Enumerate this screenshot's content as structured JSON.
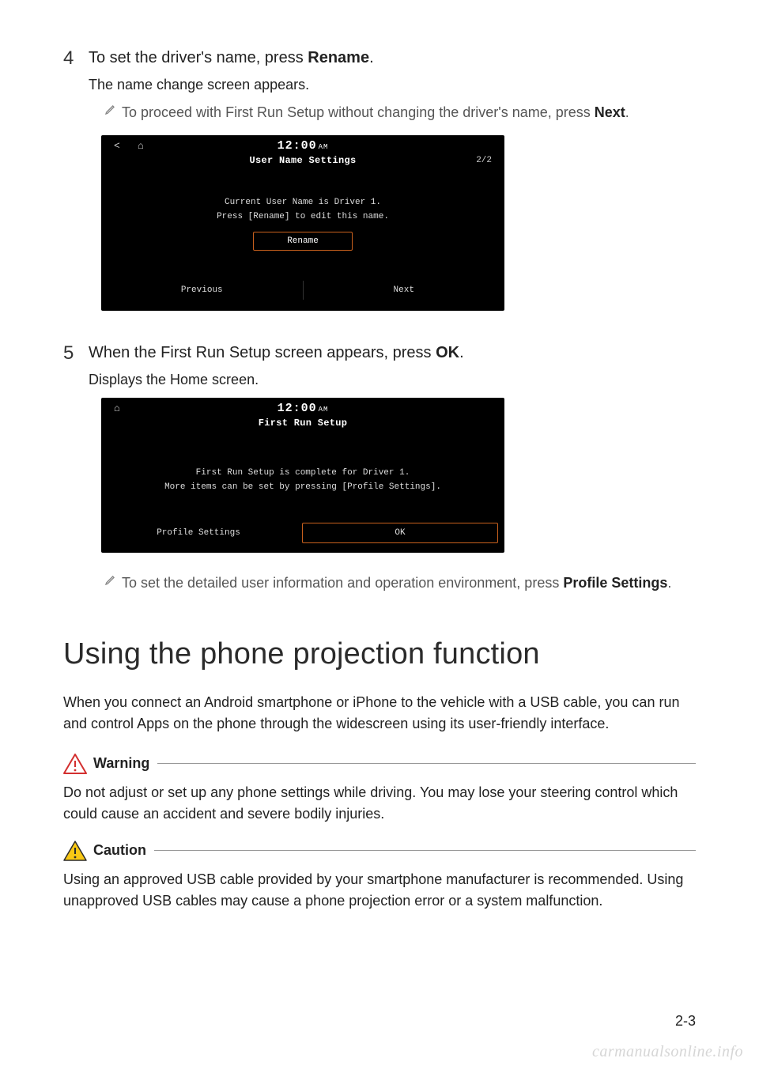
{
  "step4": {
    "num": "4",
    "title_pre": "To set the driver's name, press ",
    "title_bold": "Rename",
    "title_post": ".",
    "sub": "The name change screen appears.",
    "note_pre": "To proceed with First Run Setup without changing the driver's name, press ",
    "note_bold": "Next",
    "note_post": "."
  },
  "screenshot1": {
    "back": "<",
    "home": "⌂",
    "time": "12:00",
    "time_suffix": "AM",
    "title": "User Name Settings",
    "page": "2/2",
    "line1": "Current User Name is Driver 1.",
    "line2": "Press [Rename] to edit this name.",
    "rename": "Rename",
    "prev": "Previous",
    "next": "Next"
  },
  "step5": {
    "num": "5",
    "title_pre": "When the First Run Setup screen appears, press ",
    "title_bold": "OK",
    "title_post": ".",
    "sub": "Displays the Home screen."
  },
  "screenshot2": {
    "home": "⌂",
    "time": "12:00",
    "time_suffix": "AM",
    "title": "First Run Setup",
    "line1": "First Run Setup is complete for Driver 1.",
    "line2": "More items can be set by pressing [Profile Settings].",
    "profile": "Profile Settings",
    "ok": "OK"
  },
  "note5": {
    "pre": "To set the detailed user information and operation environment, press ",
    "bold": "Profile Settings",
    "post": "."
  },
  "section_heading": "Using the phone projection function",
  "section_para": "When you connect an Android smartphone or iPhone to the vehicle with a USB cable, you can run and control Apps on the phone through the widescreen using its user-friendly interface.",
  "warning": {
    "label": "Warning",
    "body": "Do not adjust or set up any phone settings while driving. You may lose your steering control which could cause an accident and severe bodily injuries."
  },
  "caution": {
    "label": "Caution",
    "body": "Using an approved USB cable provided by your smartphone manufacturer is recommended. Using unapproved USB cables may cause a phone projection error or a system malfunction."
  },
  "page_number": "2-3",
  "watermark": "carmanualsonline.info"
}
